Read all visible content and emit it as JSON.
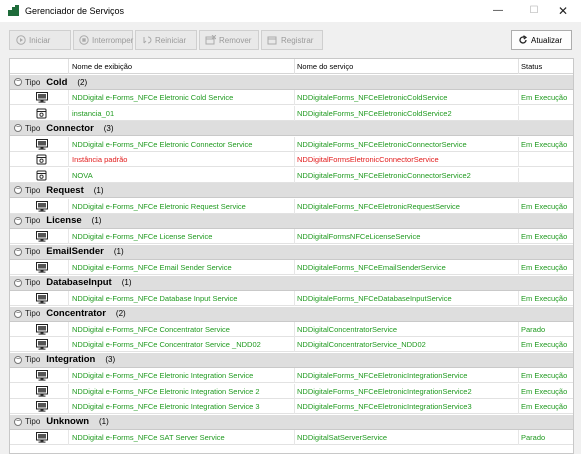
{
  "window": {
    "title": "Gerenciador de Serviços"
  },
  "toolbar": {
    "start": "Iniciar",
    "stop": "Interromper",
    "restart": "Reiniciar",
    "remove": "Remover",
    "register": "Registrar",
    "refresh": "Atualizar"
  },
  "columns": {
    "display_name": "Nome de exibição",
    "service_name": "Nome do serviço",
    "status": "Status"
  },
  "group_label": "Tipo",
  "groups": [
    {
      "name": "Cold",
      "count": "(2)",
      "rows": [
        {
          "icon": "monitor-icon",
          "display": "NDDigital e-Forms_NFCe Eletronic Cold Service",
          "service": "NDDigitaleForms_NFCeEletronicColdService",
          "status": "Em Execução",
          "color": "green"
        },
        {
          "icon": "instance-icon",
          "display": "instancia_01",
          "service": "NDDigitaleForms_NFCeEletronicColdService2",
          "status": "",
          "color": "green"
        }
      ]
    },
    {
      "name": "Connector",
      "count": "(3)",
      "rows": [
        {
          "icon": "monitor-icon",
          "display": "NDDigital e-Forms_NFCe Eletronic Connector Service",
          "service": "NDDigitaleForms_NFCeEletronicConnectorService",
          "status": "Em Execução",
          "color": "green"
        },
        {
          "icon": "instance-icon",
          "display": "Instância padrão",
          "service": "NDDigitalFormsEletronicConnectorService",
          "status": "",
          "color": "red"
        },
        {
          "icon": "instance-icon",
          "display": "NOVA",
          "service": "NDDigitaleForms_NFCeEletronicConnectorService2",
          "status": "",
          "color": "green"
        }
      ]
    },
    {
      "name": "Request",
      "count": "(1)",
      "rows": [
        {
          "icon": "monitor-icon",
          "display": "NDDigital e-Forms_NFCe Eletronic Request Service",
          "service": "NDDigitaleForms_NFCeEletronicRequestService",
          "status": "Em Execução",
          "color": "green"
        }
      ]
    },
    {
      "name": "License",
      "count": "(1)",
      "rows": [
        {
          "icon": "monitor-icon",
          "display": "NDDigital e-Forms_NFCe License Service",
          "service": "NDDigitalFormsNFCeLicenseService",
          "status": "Em Execução",
          "color": "green"
        }
      ]
    },
    {
      "name": "EmailSender",
      "count": "(1)",
      "rows": [
        {
          "icon": "monitor-icon",
          "display": "NDDigital e-Forms_NFCe Email Sender Service",
          "service": "NDDigitaleForms_NFCeEmailSenderService",
          "status": "Em Execução",
          "color": "green"
        }
      ]
    },
    {
      "name": "DatabaseInput",
      "count": "(1)",
      "rows": [
        {
          "icon": "monitor-icon",
          "display": "NDDigital e-Forms_NFCe Database Input Service",
          "service": "NDDigitaleForms_NFCeDatabaseInputService",
          "status": "Em Execução",
          "color": "green"
        }
      ]
    },
    {
      "name": "Concentrator",
      "count": "(2)",
      "rows": [
        {
          "icon": "monitor-icon",
          "display": "NDDigital e-Forms_NFCe Concentrator Service",
          "service": "NDDigitalConcentratorService",
          "status": "Parado",
          "color": "green"
        },
        {
          "icon": "monitor-icon",
          "display": "NDDigital e-Forms_NFCe Concentrator Service _NDD02",
          "service": "NDDigitalConcentratorService_NDD02",
          "status": "Em Execução",
          "color": "green"
        }
      ]
    },
    {
      "name": "Integration",
      "count": "(3)",
      "rows": [
        {
          "icon": "monitor-icon",
          "display": "NDDigital e-Forms_NFCe Eletronic Integration Service",
          "service": "NDDigitaleForms_NFCeEletronicIntegrationService",
          "status": "Em Execução",
          "color": "green"
        },
        {
          "icon": "monitor-icon",
          "display": "NDDigital e-Forms_NFCe Eletronic Integration Service 2",
          "service": "NDDigitaleForms_NFCeEletronicIntegrationService2",
          "status": "Em Execução",
          "color": "green"
        },
        {
          "icon": "monitor-icon",
          "display": "NDDigital e-Forms_NFCe Eletronic Integration Service 3",
          "service": "NDDigitaleForms_NFCeEletronicIntegrationService3",
          "status": "Em Execução",
          "color": "green"
        }
      ]
    },
    {
      "name": "Unknown",
      "count": "(1)",
      "rows": [
        {
          "icon": "monitor-icon",
          "display": "NDDigital e-Forms_NFCe SAT Server Service",
          "service": "NDDigitalSatServerService",
          "status": "Parado",
          "color": "green"
        }
      ]
    }
  ],
  "colors": {
    "running_green": "#1f9a1f",
    "error_red": "#e21b1b",
    "group_bg": "#dedede"
  }
}
